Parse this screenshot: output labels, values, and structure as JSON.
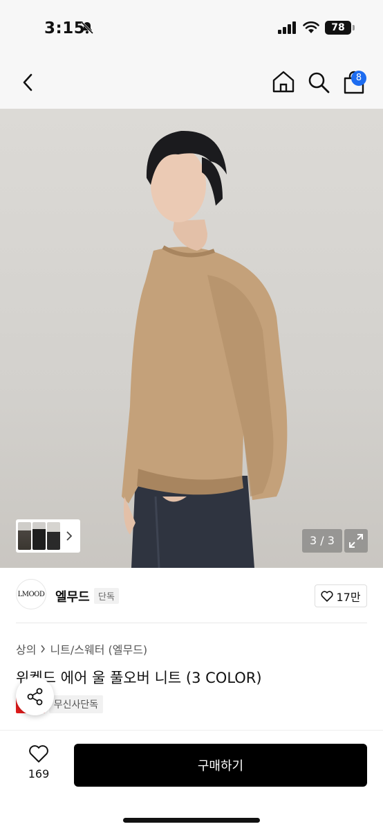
{
  "status_bar": {
    "time": "3:15",
    "battery": "78"
  },
  "nav": {
    "cart_count": "8"
  },
  "gallery": {
    "counter": "3 / 3"
  },
  "brand": {
    "logo_text": "LMOOD",
    "name": "엘무드",
    "tag": "단독",
    "likes": "17만"
  },
  "breadcrumb": {
    "category": "상의",
    "subcategory": "니트/스웨터 (엘무드)"
  },
  "product": {
    "title": "위켄드 에어 울 풀오버 니트 (3 COLOR)",
    "badge_sale": "세일",
    "badge_exclusive": "무신사단독"
  },
  "bottom": {
    "wish_count": "169",
    "buy_label": "구매하기"
  },
  "colors": {
    "accent": "#1d6cf0",
    "sale": "#e21b1b",
    "sweater": "#c4a17a"
  }
}
